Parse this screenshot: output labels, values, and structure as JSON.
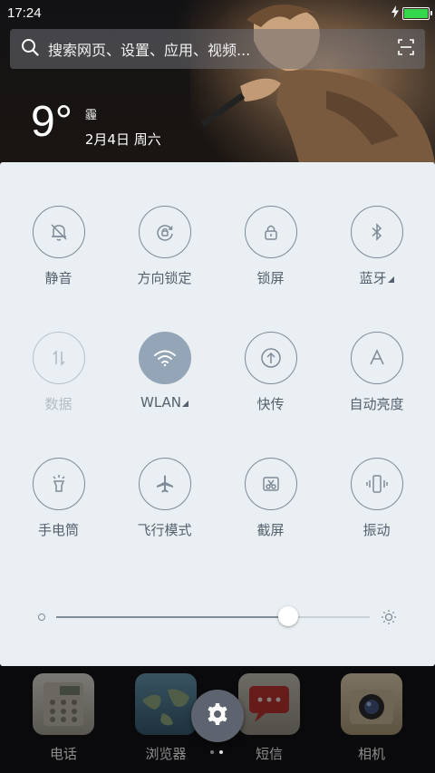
{
  "status_bar": {
    "time": "17:24",
    "battery_level": 1.0,
    "charging_icon": "bolt-icon",
    "battery_color": "#34d84a"
  },
  "search": {
    "placeholder": "搜索网页、设置、应用、视频...",
    "icon": "search-icon",
    "scan_icon": "scan-icon"
  },
  "weather": {
    "temperature": "9°",
    "condition": "霾",
    "date": "2月4日 周六"
  },
  "quick_toggles": [
    {
      "label": "静音",
      "icon": "bell-off-icon",
      "state": "off"
    },
    {
      "label": "方向锁定",
      "icon": "rotation-lock-icon",
      "state": "off"
    },
    {
      "label": "锁屏",
      "icon": "lock-icon",
      "state": "off"
    },
    {
      "label": "蓝牙",
      "icon": "bluetooth-icon",
      "state": "off"
    },
    {
      "label": "数据",
      "icon": "mobile-data-icon",
      "state": "disabled"
    },
    {
      "label": "WLAN",
      "icon": "wifi-icon",
      "state": "on"
    },
    {
      "label": "快传",
      "icon": "quick-transfer-icon",
      "state": "off"
    },
    {
      "label": "自动亮度",
      "icon": "auto-brightness-icon",
      "state": "off"
    },
    {
      "label": "手电筒",
      "icon": "flashlight-icon",
      "state": "off"
    },
    {
      "label": "飞行模式",
      "icon": "airplane-icon",
      "state": "off"
    },
    {
      "label": "截屏",
      "icon": "screenshot-icon",
      "state": "off"
    },
    {
      "label": "振动",
      "icon": "vibrate-icon",
      "state": "off"
    }
  ],
  "brightness": {
    "level": 0.74
  },
  "dock": {
    "apps": [
      {
        "label": "电话",
        "icon": "phone-icon"
      },
      {
        "label": "浏览器",
        "icon": "browser-icon"
      },
      {
        "label": "短信",
        "icon": "messages-icon"
      },
      {
        "label": "相机",
        "icon": "camera-icon"
      }
    ],
    "settings_icon": "gear-icon",
    "page_count": 2,
    "current_page": 2
  },
  "colors": {
    "panel_bg": "#e9eff2",
    "active_toggle": "#95a5b8",
    "icon_stroke": "#7f8b98"
  }
}
